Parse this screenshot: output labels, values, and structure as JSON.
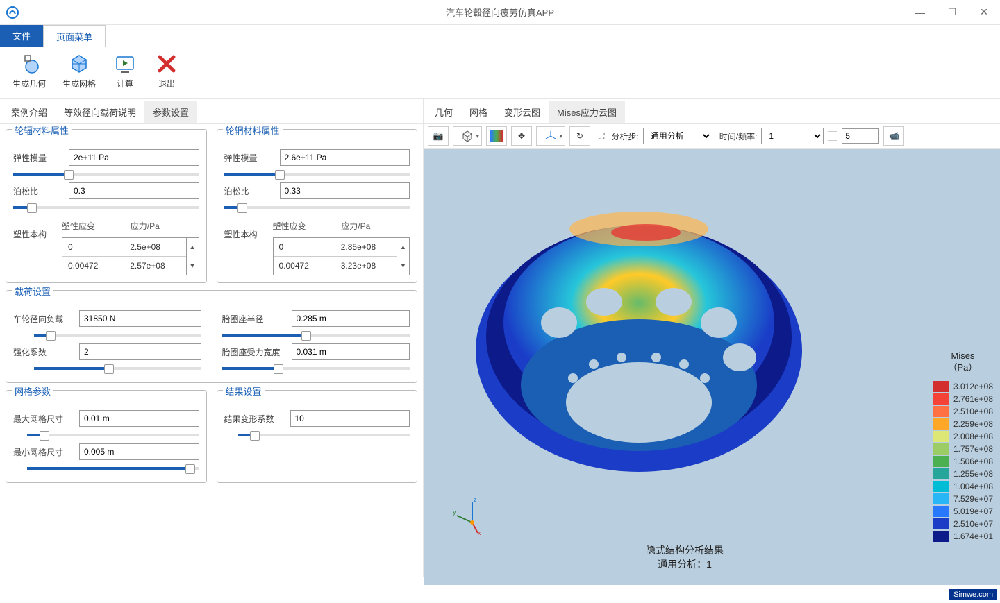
{
  "app": {
    "title": "汽车轮毂径向疲劳仿真APP"
  },
  "menu": {
    "file": "文件",
    "page": "页面菜单"
  },
  "ribbon": {
    "geom": "生成几何",
    "mesh": "生成网格",
    "calc": "计算",
    "exit": "退出"
  },
  "leftTabs": {
    "t1": "案例介绍",
    "t2": "等效径向载荷说明",
    "t3": "参数设置"
  },
  "rightTabs": {
    "t1": "几何",
    "t2": "网格",
    "t3": "变形云图",
    "t4": "Mises应力云图"
  },
  "matA": {
    "title": "轮辐材料属性",
    "elasticLabel": "弹性模量",
    "elastic": "2e+11 Pa",
    "poissonLabel": "泊松比",
    "poisson": "0.3",
    "plasticLabel": "塑性本构",
    "col1": "塑性应变",
    "col2": "应力/Pa",
    "r1c1": "0",
    "r1c2": "2.5e+08",
    "r2c1": "0.00472",
    "r2c2": "2.57e+08"
  },
  "matB": {
    "title": "轮辋材料属性",
    "elasticLabel": "弹性模量",
    "elastic": "2.6e+11 Pa",
    "poissonLabel": "泊松比",
    "poisson": "0.33",
    "plasticLabel": "塑性本构",
    "col1": "塑性应变",
    "col2": "应力/Pa",
    "r1c1": "0",
    "r1c2": "2.85e+08",
    "r2c1": "0.00472",
    "r2c2": "3.23e+08"
  },
  "load": {
    "title": "载荷设置",
    "radialLabel": "车轮径向负载",
    "radial": "31850 N",
    "strengthLabel": "强化系数",
    "strength": "2",
    "radiusLabel": "胎圈座半径",
    "radius": "0.285 m",
    "widthLabel": "胎圈座受力宽度",
    "width": "0.031 m"
  },
  "mesh": {
    "title": "网格参数",
    "maxLabel": "最大网格尺寸",
    "max": "0.01 m",
    "minLabel": "最小网格尺寸",
    "min": "0.005 m"
  },
  "result": {
    "title": "结果设置",
    "scaleLabel": "结果变形系数",
    "scale": "10"
  },
  "viewerTB": {
    "stepLabel": "分析步:",
    "step": "通用分析",
    "timeLabel": "时间/频率:",
    "time": "1",
    "spin": "5"
  },
  "viewer": {
    "text1": "隐式结构分析结果",
    "text2": "通用分析：1",
    "legendTitle1": "Mises",
    "legendTitle2": "（Pa）"
  },
  "legend": [
    {
      "c": "#d32f2f",
      "v": "3.012e+08"
    },
    {
      "c": "#f44336",
      "v": "2.761e+08"
    },
    {
      "c": "#ff7043",
      "v": "2.510e+08"
    },
    {
      "c": "#ffa726",
      "v": "2.259e+08"
    },
    {
      "c": "#dce775",
      "v": "2.008e+08"
    },
    {
      "c": "#9ccc65",
      "v": "1.757e+08"
    },
    {
      "c": "#4caf50",
      "v": "1.506e+08"
    },
    {
      "c": "#26a69a",
      "v": "1.255e+08"
    },
    {
      "c": "#00bcd4",
      "v": "1.004e+08"
    },
    {
      "c": "#29b6f6",
      "v": "7.529e+07"
    },
    {
      "c": "#2979ff",
      "v": "5.019e+07"
    },
    {
      "c": "#1a3cc7",
      "v": "2.510e+07"
    },
    {
      "c": "#0d1a8a",
      "v": "1.674e+01"
    }
  ],
  "watermark": "Simwe.com"
}
